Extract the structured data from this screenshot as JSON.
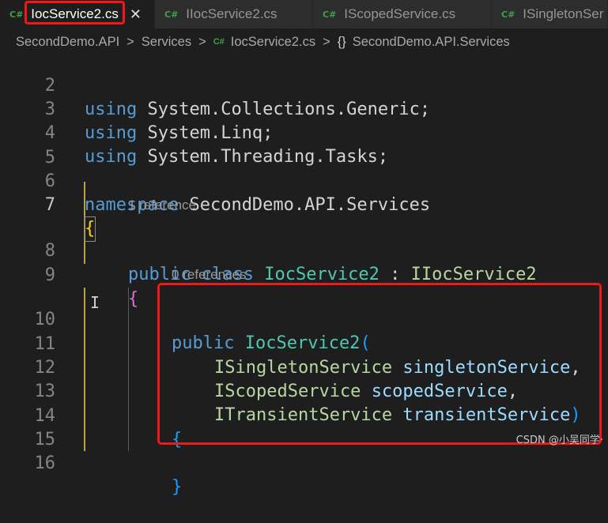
{
  "tabs": [
    {
      "icon": "C#",
      "label": "IocService2.cs",
      "close": "✕",
      "active": true
    },
    {
      "icon": "C#",
      "label": "IIocService2.cs",
      "active": false
    },
    {
      "icon": "C#",
      "label": "IScopedService.cs",
      "active": false
    },
    {
      "icon": "C#",
      "label": "ISingletonSer",
      "active": false
    }
  ],
  "breadcrumb": {
    "project": "SecondDemo.API",
    "folder": "Services",
    "file_icon": "C#",
    "file": "IocService2.cs",
    "namespace_icon": "{}",
    "namespace": "SecondDemo.API.Services",
    "separator": ">"
  },
  "editor": {
    "lines": {
      "l2": {
        "num": "2",
        "kw": "using",
        "rest": " System.Collections.Generic;"
      },
      "l3": {
        "num": "3",
        "kw": "using",
        "rest": " System.Linq;"
      },
      "l4": {
        "num": "4",
        "kw": "using",
        "rest": " System.Threading.Tasks;"
      },
      "l5": {
        "num": "5"
      },
      "l6": {
        "num": "6",
        "kw": "namespace",
        "rest": " SecondDemo.API.Services"
      },
      "l7": {
        "num": "7",
        "brace": "{"
      },
      "l8": {
        "num": "8",
        "kw1": "public",
        "kw2": "class",
        "type": "IocService2",
        "colon": " : ",
        "iface": "IIocService2"
      },
      "l9": {
        "num": "9",
        "brace": "{"
      },
      "l10": {
        "num": "10",
        "kw": "public",
        "type": "IocService2",
        "paren": "("
      },
      "l11": {
        "num": "11",
        "iface": "ISingletonService",
        "param": "singletonService",
        "punc": ","
      },
      "l12": {
        "num": "12",
        "iface": "IScopedService",
        "param": "scopedService",
        "punc": ","
      },
      "l13": {
        "num": "13",
        "iface": "ITransientService",
        "param": "transientService",
        "punc": ")"
      },
      "l14": {
        "num": "14",
        "brace": "{"
      },
      "l15": {
        "num": "15"
      },
      "l16": {
        "num": "16",
        "brace": "}"
      }
    },
    "codelens": {
      "class_refs": "1 reference",
      "ctor_refs": "0 references"
    }
  },
  "watermark": "CSDN @小吴同学·"
}
